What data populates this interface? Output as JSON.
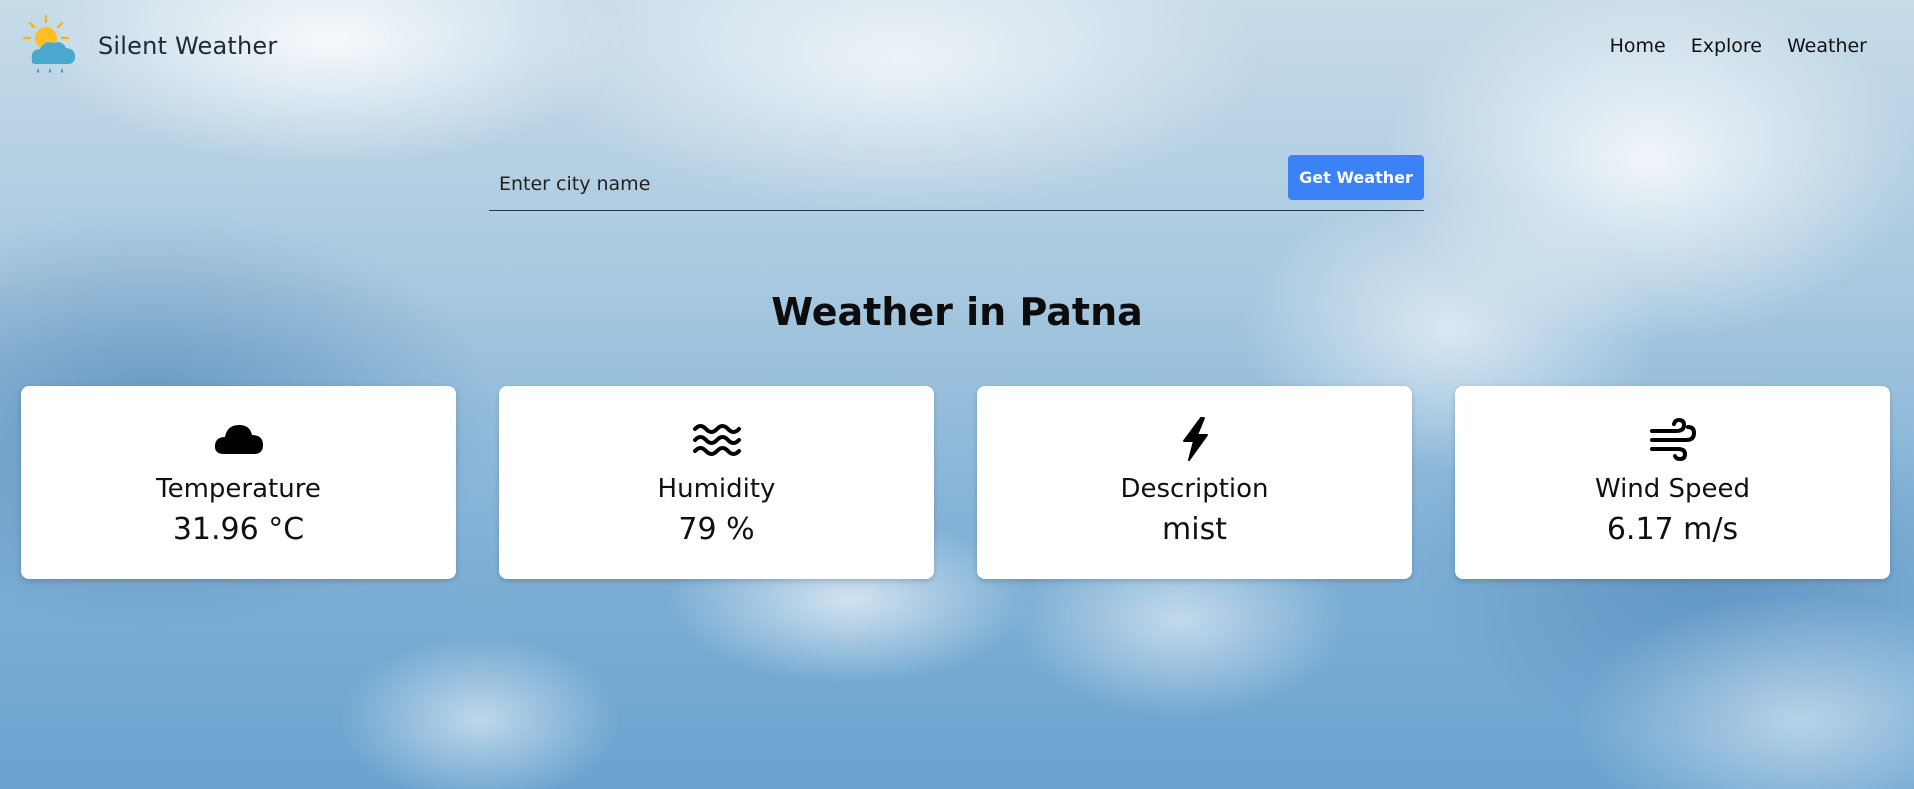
{
  "brand": {
    "name": "Silent Weather"
  },
  "nav": {
    "items": [
      "Home",
      "Explore",
      "Weather"
    ]
  },
  "search": {
    "placeholder": "Enter city name",
    "value": "",
    "button_label": "Get Weather"
  },
  "heading": "Weather in Patna",
  "cards": [
    {
      "icon": "cloud-icon",
      "label": "Temperature",
      "value": "31.96 °C"
    },
    {
      "icon": "water-waves-icon",
      "label": "Humidity",
      "value": "79 %"
    },
    {
      "icon": "lightning-bolt-icon",
      "label": "Description",
      "value": "mist"
    },
    {
      "icon": "wind-icon",
      "label": "Wind Speed",
      "value": "6.17 m/s"
    }
  ],
  "colors": {
    "accent": "#3b82f6",
    "card_bg": "#ffffff",
    "text": "#111111"
  }
}
